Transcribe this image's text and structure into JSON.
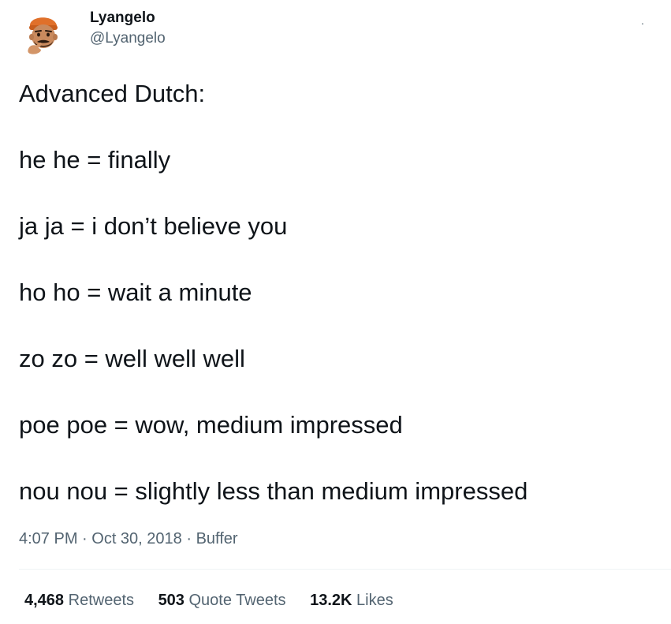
{
  "author": {
    "display_name": "Lyangelo",
    "handle": "@Lyangelo",
    "avatar_icon": "memoji-thinking-orange-beanie-icon"
  },
  "tweet": {
    "lines": [
      "Advanced Dutch:",
      "he he = finally",
      "ja ja = i don’t believe you",
      "ho ho = wait a minute",
      "zo zo = well well well",
      "poe poe = wow, medium impressed",
      "nou nou = slightly less than medium impressed"
    ]
  },
  "meta": {
    "time": "4:07 PM",
    "sep1": " · ",
    "date": "Oct 30, 2018",
    "sep2": " · ",
    "source": "Buffer"
  },
  "stats": {
    "retweets_count": "4,468",
    "retweets_label": "Retweets",
    "quote_count": "503",
    "quote_label": "Quote Tweets",
    "likes_count": "13.2K",
    "likes_label": "Likes"
  },
  "colors": {
    "text_primary": "#0f1419",
    "text_secondary": "#536471",
    "divider": "#eff3f4",
    "avatar_hat": "#e0702a"
  }
}
